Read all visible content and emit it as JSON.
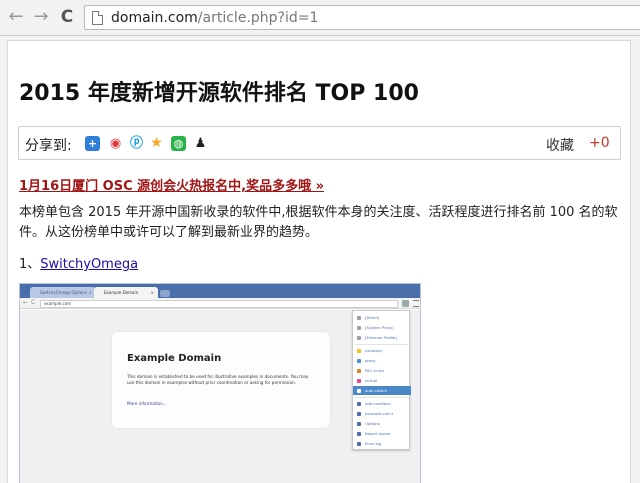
{
  "browser": {
    "url_domain": "domain.com",
    "url_path": "/article.php?id=1",
    "back_icon": "←",
    "forward_icon": "→",
    "reload_icon": "C"
  },
  "article": {
    "title": "2015 年度新增开源软件排名 TOP 100",
    "share_label": "分享到:",
    "share_icons": [
      "plus-icon",
      "weibo-icon",
      "pengyou-icon",
      "qzone-icon",
      "wechat-icon",
      "qq-icon"
    ],
    "favorite_label": "收藏",
    "favorite_count": "+0",
    "promo_link": "1月16日厦门 OSC 源创会火热报名中,奖品多多哦 »",
    "body": "本榜单包含 2015 年开源中国新收录的软件中,根据软件本身的关注度、活跃程度进行排名前 100 名的软件。从这份榜单中或许可以了解到最新业界的趋势。",
    "list_prefix": "1、",
    "list_link": "SwitchyOmega"
  },
  "screenshot": {
    "tab1": "SwitchyOmega Options",
    "tab2": "Example Domain",
    "url": "example.com",
    "card_title": "Example Domain",
    "card_text": "This domain is established to be used for illustrative examples in documents. You may use this domain in examples without prior coordination or asking for permission.",
    "card_link": "More information...",
    "menu": [
      {
        "label": "[Direct]",
        "color": "#9aa0a6"
      },
      {
        "label": "[System Proxy]",
        "color": "#9aa0a6"
      },
      {
        "label": "[External Profile]",
        "color": "#9aa0a6"
      },
      {
        "label": "company",
        "color": "#f1c40f"
      },
      {
        "label": "proxy",
        "color": "#4a90d9"
      },
      {
        "label": "PAC script",
        "color": "#e67e22"
      },
      {
        "label": "virtual",
        "color": "#e84393"
      },
      {
        "label": "auto switch",
        "color": "#ffffff"
      },
      {
        "label": "add condition",
        "color": "#4a6ea9"
      },
      {
        "label": "example.com+",
        "color": "#4a6ea9"
      },
      {
        "label": "Options",
        "color": "#4a6ea9"
      },
      {
        "label": "Report issues",
        "color": "#4a6ea9"
      },
      {
        "label": "Error log",
        "color": "#4a6ea9"
      }
    ]
  }
}
